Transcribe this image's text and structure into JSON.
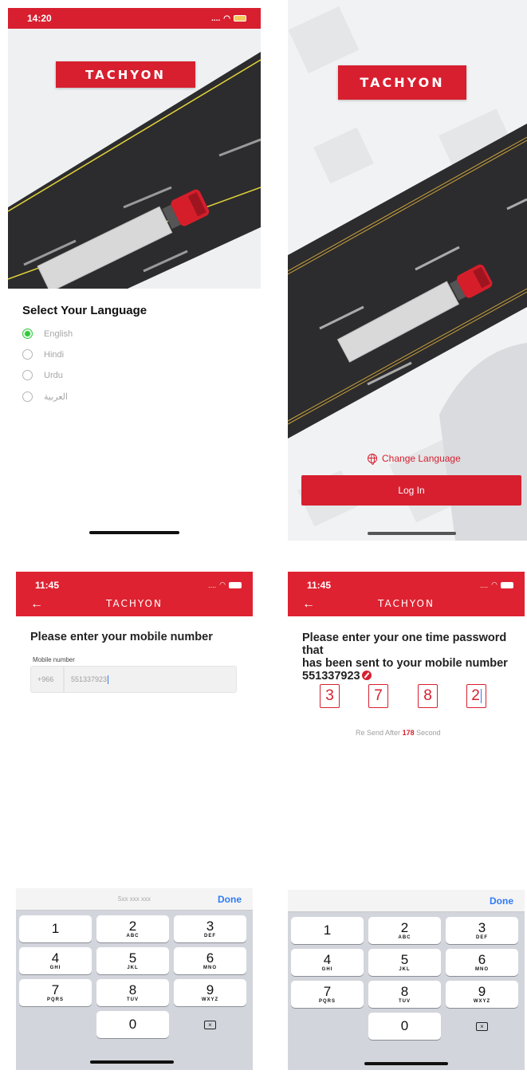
{
  "screen_language": {
    "status_time": "14:20",
    "logo_text": "TACHYON",
    "title": "Select Your Language",
    "options": [
      {
        "label": "English",
        "selected": true
      },
      {
        "label": "Hindi",
        "selected": false
      },
      {
        "label": "Urdu",
        "selected": false
      },
      {
        "label": "العربية",
        "selected": false
      }
    ]
  },
  "screen_login": {
    "logo_text": "TACHYON",
    "change_language": "Change Language",
    "login_button": "Log In"
  },
  "screen_mobile": {
    "status_time": "11:45",
    "header_title": "TACHYON",
    "back_icon": "←",
    "title": "Please enter your mobile number",
    "field_label": "Mobile number",
    "country_code": "+966",
    "phone_value": "551337923",
    "keypad_placeholder": "5xx xxx xxx",
    "keypad_done": "Done"
  },
  "screen_otp": {
    "status_time": "11:45",
    "header_title": "TACHYON",
    "back_icon": "←",
    "title_line1": "Please enter your one time password that",
    "title_line2": "has been sent to your mobile number",
    "phone_number": "551337923",
    "otp_digits": [
      "3",
      "7",
      "8",
      "2"
    ],
    "resend_prefix": "Re Send After",
    "resend_seconds": "178",
    "resend_suffix": "Second",
    "keypad_done": "Done"
  },
  "keypad": {
    "keys": [
      {
        "digit": "1",
        "letters": ""
      },
      {
        "digit": "2",
        "letters": "ABC"
      },
      {
        "digit": "3",
        "letters": "DEF"
      },
      {
        "digit": "4",
        "letters": "GHI"
      },
      {
        "digit": "5",
        "letters": "JKL"
      },
      {
        "digit": "6",
        "letters": "MNO"
      },
      {
        "digit": "7",
        "letters": "PQRS"
      },
      {
        "digit": "8",
        "letters": "TUV"
      },
      {
        "digit": "9",
        "letters": "WXYZ"
      },
      {
        "digit": "0",
        "letters": ""
      }
    ],
    "delete_symbol": "×"
  },
  "colors": {
    "brand_red": "#d71f2f",
    "selected_green": "#31c83e",
    "link_blue": "#2f7cf6",
    "road": "#2c2c2e"
  },
  "icons": {
    "globe": "globe-icon",
    "back": "back-arrow-icon",
    "delete": "backspace-icon",
    "edit": "edit-icon"
  }
}
